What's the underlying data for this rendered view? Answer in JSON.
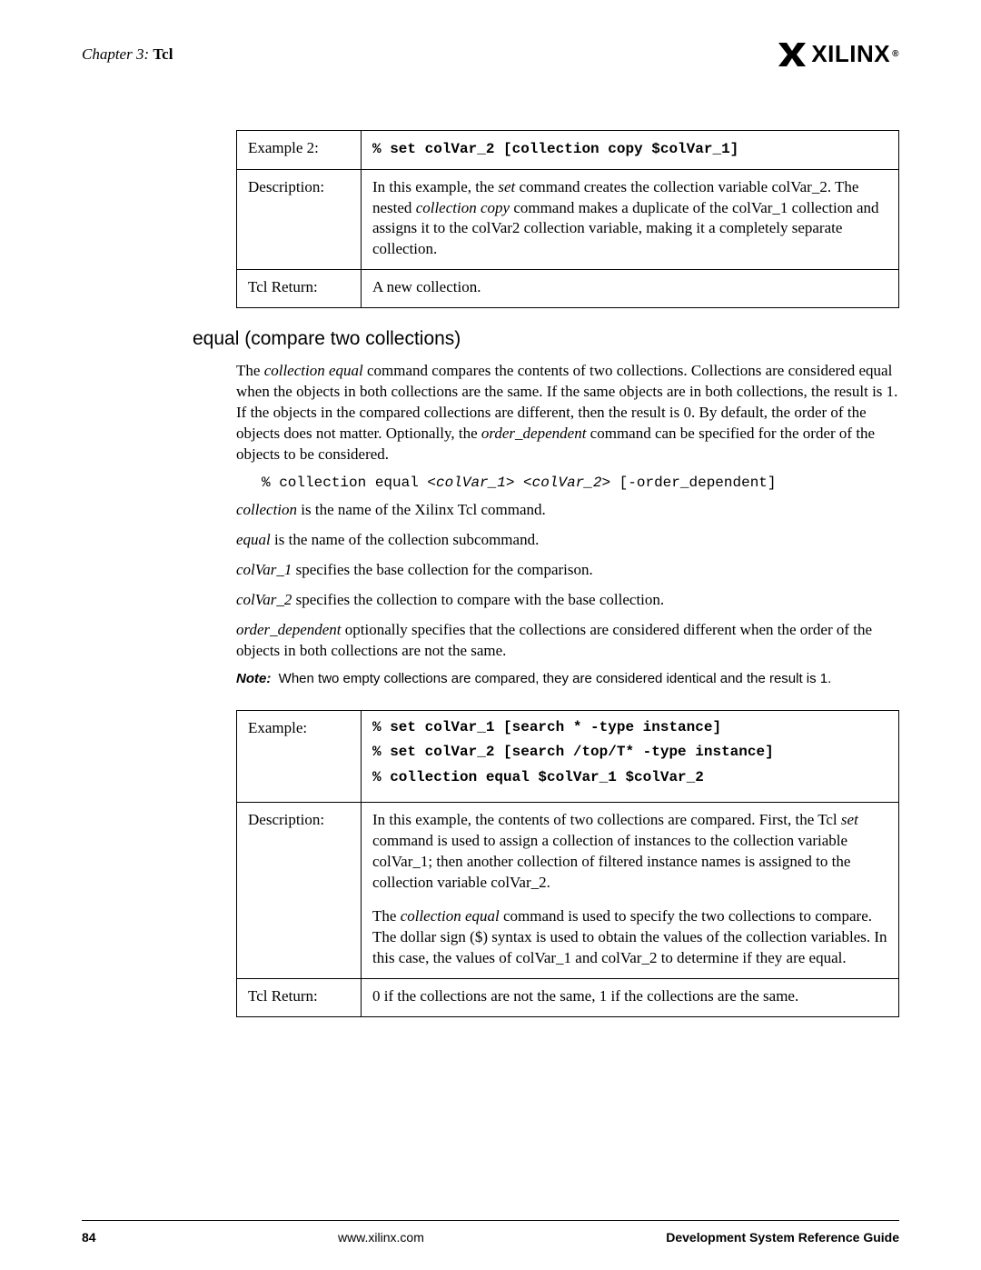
{
  "header": {
    "chapter_prefix": "Chapter 3:",
    "chapter_name": "Tcl",
    "logo_text": "XILINX",
    "logo_reg": "®"
  },
  "table1": {
    "row1_label": "Example 2:",
    "row1_code": "% set colVar_2 [collection copy $colVar_1]",
    "row2_label": "Description:",
    "row2_text_1": "In this example, the ",
    "row2_em_1": "set",
    "row2_text_2": " command creates the collection variable colVar_2. The nested ",
    "row2_em_2": "collection copy",
    "row2_text_3": " command makes a duplicate of the colVar_1 collection and assigns it to the colVar2 collection variable, making it a completely separate collection.",
    "row3_label": "Tcl Return:",
    "row3_text": "A new collection."
  },
  "section": {
    "title": "equal (compare two collections)",
    "p1_a": "The ",
    "p1_em1": "collection equal",
    "p1_b": " command compares the contents of two collections. Collections are considered equal when the objects in both collections are the same. If the same objects are in both collections, the result is 1. If the objects in the compared collections are different, then the result is 0. By default, the order of the objects does not matter. Optionally, the ",
    "p1_em2": "order_dependent",
    "p1_c": " command can be specified for the order of the objects to be considered.",
    "syntax_a": "% collection equal <",
    "syntax_i1": "colVar_1",
    "syntax_b": "> <",
    "syntax_i2": "colVar_2",
    "syntax_c": "> [-order_dependent]",
    "p2_em": "collection",
    "p2_rest": " is the name of the Xilinx Tcl command.",
    "p3_em": "equal",
    "p3_rest": " is the name of the collection subcommand.",
    "p4_em": "colVar_1",
    "p4_rest": " specifies the base collection for the comparison.",
    "p5_em": "colVar_2",
    "p5_rest": " specifies the collection to compare with the base collection.",
    "p6_em": "order_dependent",
    "p6_rest": " optionally specifies that the collections are considered different when the order of the objects in both collections are not the same.",
    "note_label": "Note:",
    "note_text": "When two empty collections are compared, they are considered identical and the result is 1."
  },
  "table2": {
    "row1_label": "Example:",
    "code1": "% set colVar_1 [search * -type instance]",
    "code2": "% set colVar_2 [search /top/T* -type instance]",
    "code3": "% collection equal $colVar_1 $colVar_2",
    "row2_label": "Description:",
    "d1_a": "In this example, the contents of two collections are compared. First, the Tcl ",
    "d1_em": "set",
    "d1_b": " command is used to assign a collection of instances to the collection variable colVar_1; then another collection of filtered instance names is assigned to the collection variable colVar_2.",
    "d2_a": "The ",
    "d2_em": "collection equal",
    "d2_b": " command is used to specify the two collections to compare. The dollar sign ($) syntax is used to obtain the values of the collection variables. In this case, the values of colVar_1 and colVar_2 to determine if they are equal.",
    "row3_label": "Tcl Return:",
    "row3_text": "0 if the collections are not the same, 1 if the collections are the same."
  },
  "footer": {
    "page": "84",
    "url": "www.xilinx.com",
    "guide": "Development System Reference Guide"
  }
}
